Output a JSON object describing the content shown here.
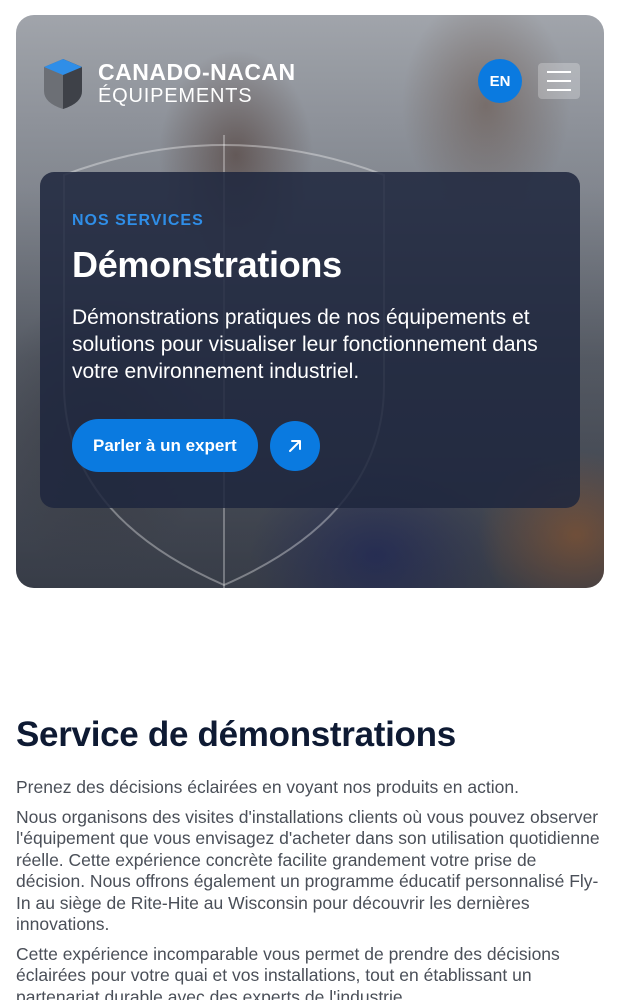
{
  "header": {
    "logo_line1": "CANADO-NACAN",
    "logo_line2": "ÉQUIPEMENTS",
    "lang_label": "EN",
    "menu_icon": "hamburger-menu-icon"
  },
  "hero": {
    "eyebrow": "NOS SERVICES",
    "title": "Démonstrations",
    "description": "Démonstrations pratiques de nos équipements et solutions pour visualiser leur fonctionnement dans votre environnement industriel.",
    "cta_label": "Parler à un expert",
    "arrow_icon": "arrow-up-right-icon"
  },
  "section": {
    "title": "Service de démonstrations",
    "paragraphs": [
      "Prenez des décisions éclairées en voyant nos produits en action.",
      "Nous organisons des visites d'installations clients où vous pouvez observer l'équipement que vous envisagez d'acheter dans son utilisation quotidienne réelle. Cette expérience concrète facilite grandement votre prise de décision. Nous offrons également un programme éducatif personnalisé Fly-In au siège de Rite-Hite au Wisconsin pour découvrir les dernières innovations.",
      "Cette expérience incomparable vous permet de prendre des décisions éclairées pour votre quai et vos installations, tout en établissant un partenariat durable avec des experts de l'industrie."
    ]
  },
  "colors": {
    "accent": "#0a7ae0",
    "card_bg": "#1e263e",
    "heading": "#0e1a33",
    "body_text": "#4a4f58"
  }
}
